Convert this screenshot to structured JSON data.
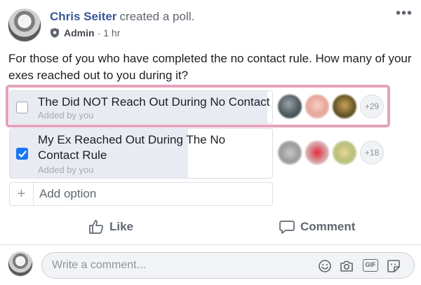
{
  "post": {
    "author_name": "Chris Seiter",
    "action_text": "created a poll.",
    "role": "Admin",
    "separator": "·",
    "time": "1 hr",
    "more_icon": "more-dots-icon",
    "question": "For those of you who have completed the no contact rule. How many of your exes reached out to you during it?"
  },
  "poll": {
    "options": [
      {
        "label": "The Did NOT Reach Out During No Contact",
        "added_by": "Added by you",
        "checked": false,
        "vote_share": 0.98,
        "voters_extra": "+29"
      },
      {
        "label": "My Ex Reached Out During The No Contact Rule",
        "added_by": "Added by you",
        "checked": true,
        "vote_share": 0.68,
        "voters_extra": "+18"
      }
    ],
    "add_option_label": "Add option",
    "add_option_icon": "+"
  },
  "actions": {
    "like_label": "Like",
    "comment_label": "Comment"
  },
  "composer": {
    "placeholder": "Write a comment..."
  },
  "colors": {
    "link_blue": "#385898",
    "check_blue": "#1877f2",
    "highlight_pink": "#e4a2bd",
    "vote_bar": "#e8ebf2"
  }
}
